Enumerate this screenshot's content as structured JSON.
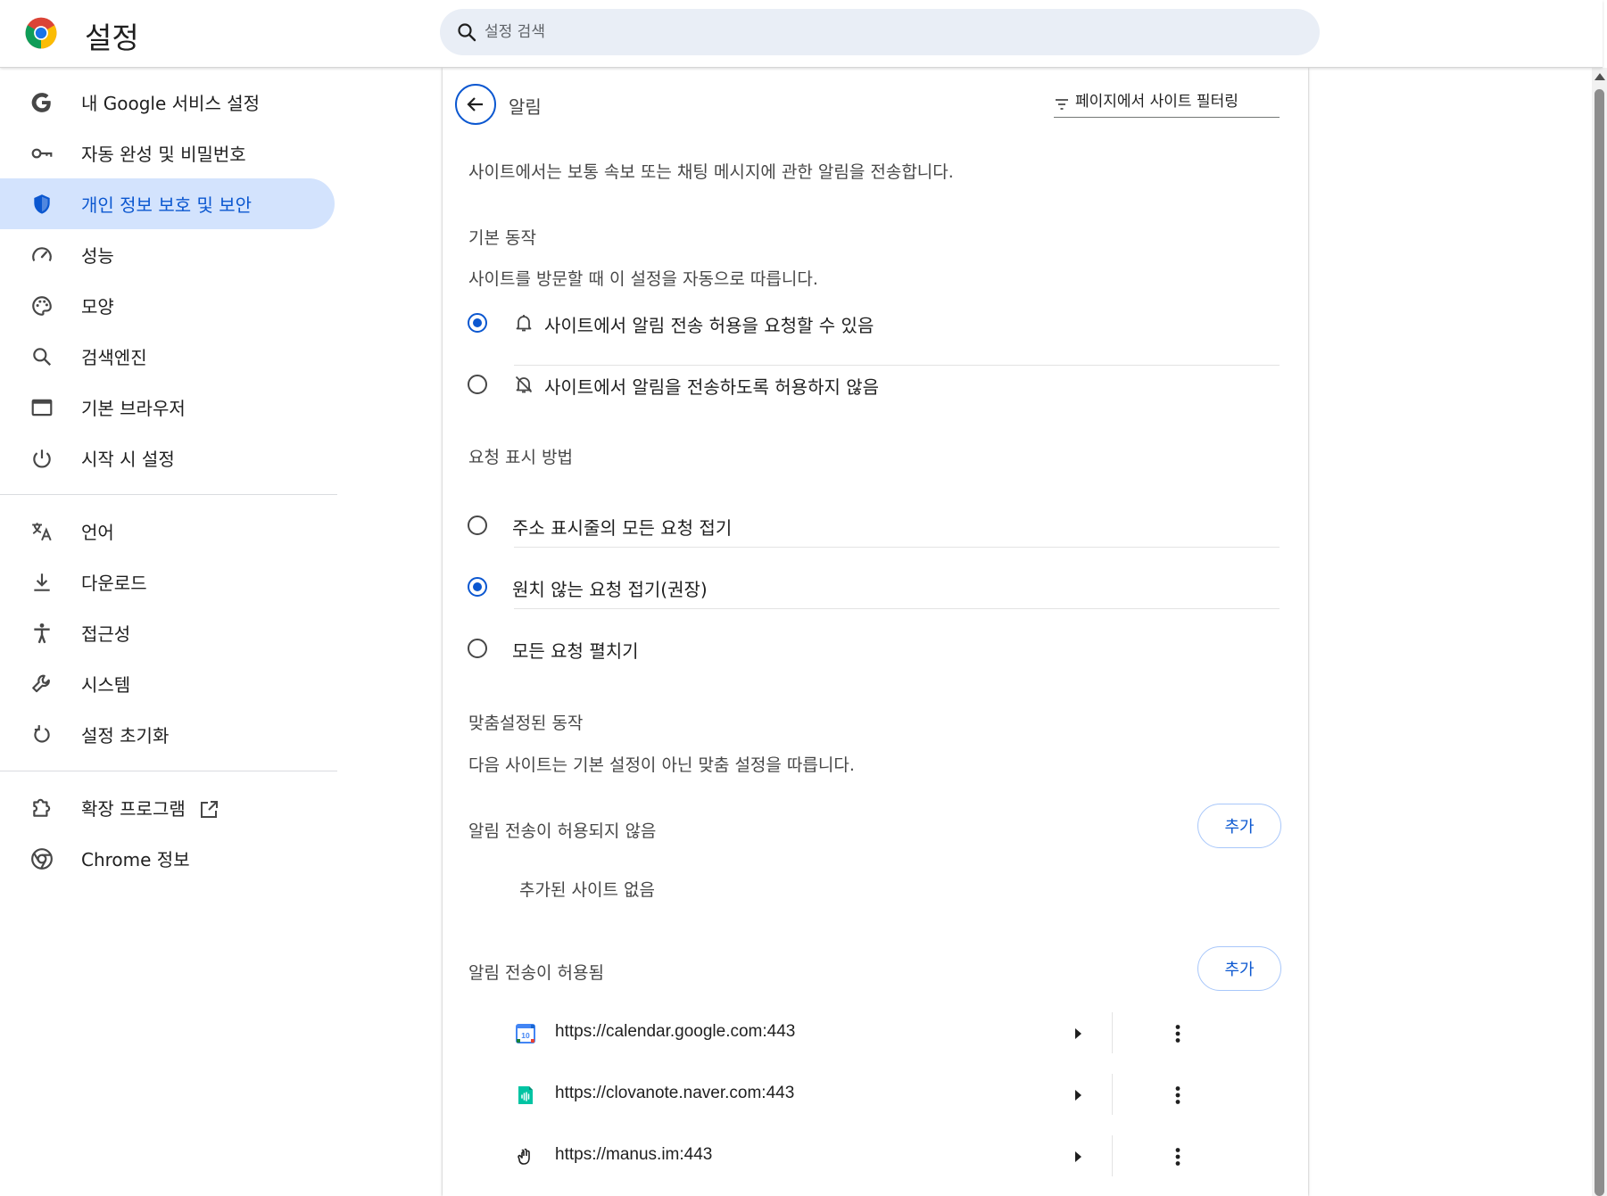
{
  "header": {
    "title": "설정",
    "search_placeholder": "설정 검색"
  },
  "sidebar": {
    "items": [
      {
        "label": "내 Google 서비스 설정",
        "icon": "google-g-icon"
      },
      {
        "label": "자동 완성 및 비밀번호",
        "icon": "key-icon"
      },
      {
        "label": "개인 정보 보호 및 보안",
        "icon": "shield-icon",
        "active": true
      },
      {
        "label": "성능",
        "icon": "speedometer-icon"
      },
      {
        "label": "모양",
        "icon": "palette-icon"
      },
      {
        "label": "검색엔진",
        "icon": "search-icon"
      },
      {
        "label": "기본 브라우저",
        "icon": "browser-window-icon"
      },
      {
        "label": "시작 시 설정",
        "icon": "power-icon"
      },
      {
        "label": "언어",
        "icon": "translate-icon"
      },
      {
        "label": "다운로드",
        "icon": "download-icon"
      },
      {
        "label": "접근성",
        "icon": "accessibility-icon"
      },
      {
        "label": "시스템",
        "icon": "wrench-icon"
      },
      {
        "label": "설정 초기화",
        "icon": "reset-icon"
      },
      {
        "label": "확장 프로그램",
        "icon": "extension-icon"
      },
      {
        "label": "Chrome 정보",
        "icon": "chrome-icon"
      }
    ]
  },
  "page": {
    "title": "알림",
    "filter_placeholder": "페이지에서 사이트 필터링",
    "description": "사이트에서는 보통 속보 또는 채팅 메시지에 관한 알림을 전송합니다.",
    "default_behavior": {
      "heading": "기본 동작",
      "description": "사이트를 방문할 때 이 설정을 자동으로 따릅니다.",
      "options": [
        {
          "label": "사이트에서 알림 전송 허용을 요청할 수 있음",
          "icon": "bell-icon",
          "checked": true
        },
        {
          "label": "사이트에서 알림을 전송하도록 허용하지 않음",
          "icon": "bell-off-icon",
          "checked": false
        }
      ]
    },
    "request_display": {
      "heading": "요청 표시 방법",
      "options": [
        {
          "label": "주소 표시줄의 모든 요청 접기",
          "checked": false
        },
        {
          "label": "원치 않는 요청 접기(권장)",
          "checked": true
        },
        {
          "label": "모든 요청 펼치기",
          "checked": false
        }
      ]
    },
    "custom_behavior": {
      "heading": "맞춤설정된 동작",
      "description": "다음 사이트는 기본 설정이 아닌 맞춤 설정을 따릅니다.",
      "blocked": {
        "heading": "알림 전송이 허용되지 않음",
        "add_label": "추가",
        "empty_text": "추가된 사이트 없음"
      },
      "allowed": {
        "heading": "알림 전송이 허용됨",
        "add_label": "추가",
        "sites": [
          {
            "url": "https://calendar.google.com:443",
            "favicon": "google-calendar-icon"
          },
          {
            "url": "https://clovanote.naver.com:443",
            "favicon": "clovanote-icon"
          },
          {
            "url": "https://manus.im:443",
            "favicon": "manus-icon"
          }
        ]
      }
    }
  },
  "colors": {
    "accent": "#0b57d0",
    "active_bg": "#d3e3fd",
    "search_bg": "#e9eef6"
  }
}
